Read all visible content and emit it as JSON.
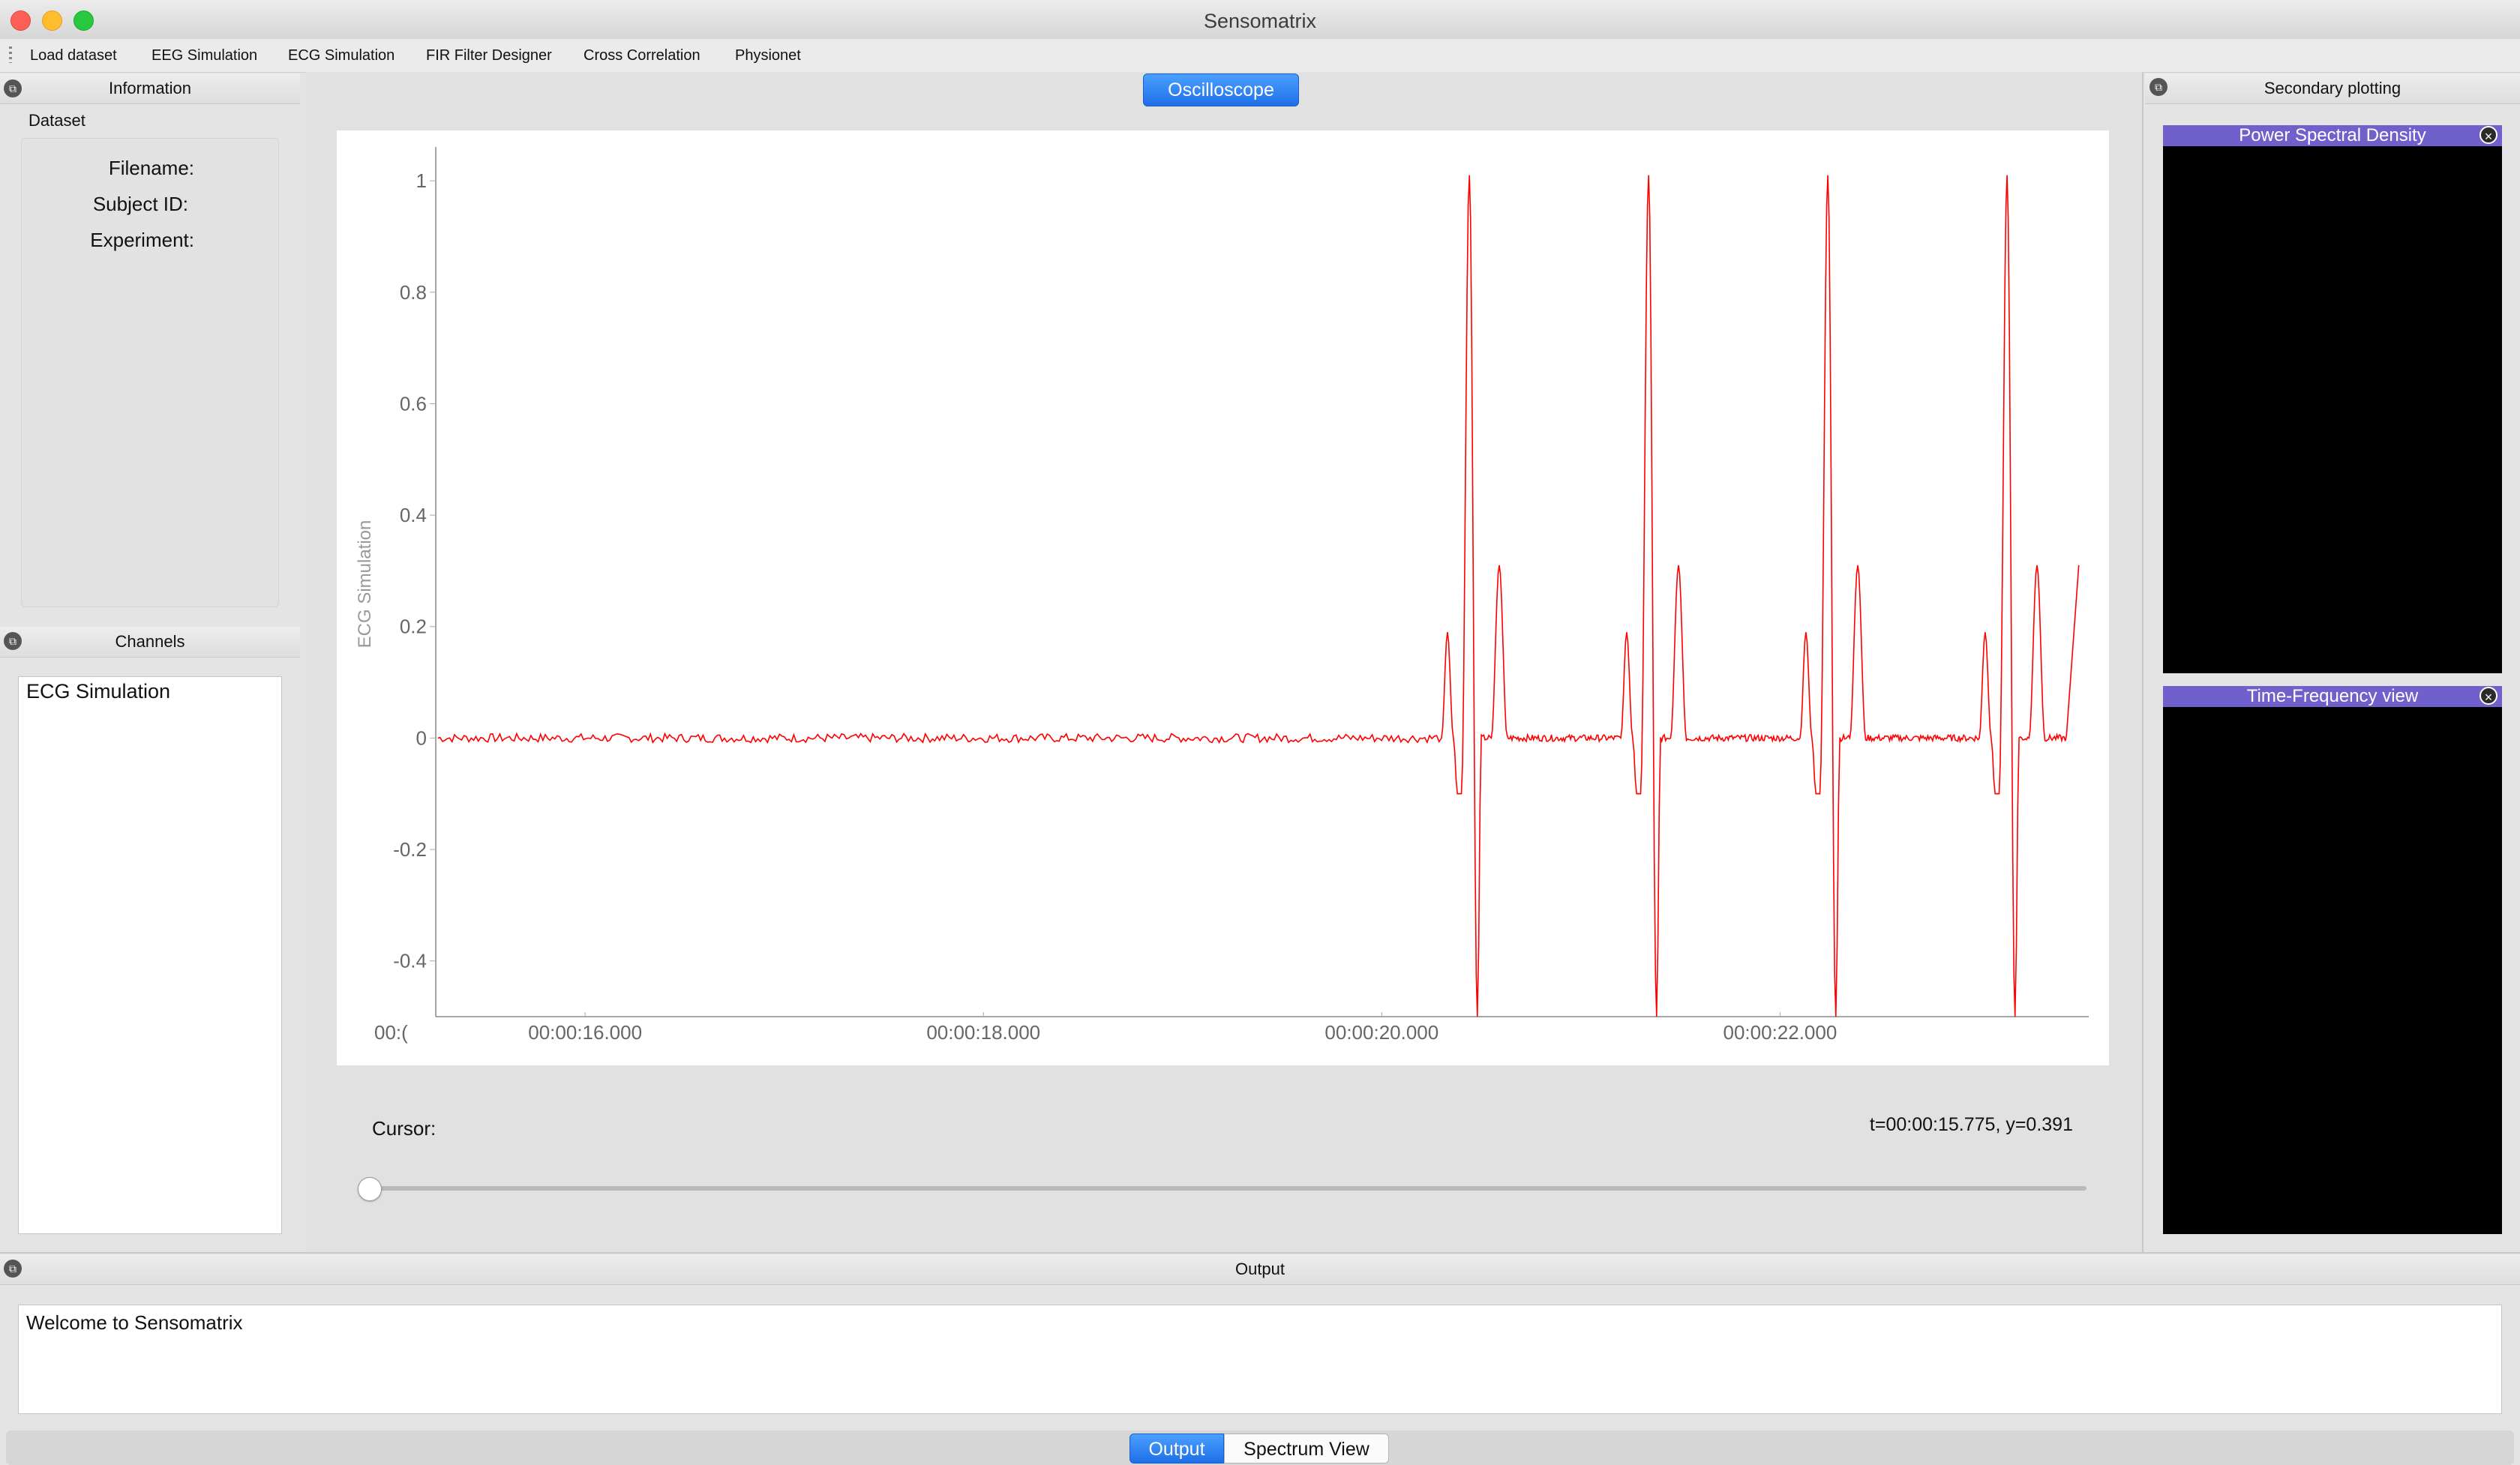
{
  "window": {
    "title": "Sensomatrix"
  },
  "menu": [
    "Load dataset",
    "EEG Simulation",
    "ECG Simulation",
    "FIR Filter Designer",
    "Cross Correlation",
    "Physionet"
  ],
  "info_panel": {
    "header": "Information",
    "section": "Dataset",
    "fields": {
      "filename": "Filename:",
      "subject_id": "Subject ID:",
      "experiment": "Experiment:"
    }
  },
  "channels_panel": {
    "header": "Channels",
    "items": [
      "ECG Simulation"
    ]
  },
  "oscilloscope": {
    "tab_label": "Oscilloscope",
    "cursor_label": "Cursor:",
    "cursor_readout": "t=00:00:15.775, y=0.391",
    "slider_value": 0
  },
  "secondary": {
    "header": "Secondary plotting",
    "psd_title": "Power Spectral Density",
    "tf_title": "Time-Frequency view"
  },
  "output": {
    "header": "Output",
    "message": "Welcome to Sensomatrix",
    "tabs": [
      "Output",
      "Spectrum View"
    ],
    "active_tab": "Output"
  },
  "colors": {
    "accent": "#1f6fe8",
    "trace": "#ff0000",
    "dock_title": "#7060cc"
  },
  "chart_data": {
    "type": "line",
    "ylabel": "ECG Simulation",
    "xlabel": "",
    "xlim_seconds": [
      15.25,
      23.55
    ],
    "ylim": [
      -0.5,
      1.05
    ],
    "y_ticks": [
      "1",
      "0.8",
      "0.6",
      "0.4",
      "0.2",
      "0",
      "-0.2",
      "-0.4"
    ],
    "x_tick_seconds": [
      16,
      18,
      20,
      22
    ],
    "x_ticks": [
      "00:00:16.000",
      "00:00:18.000",
      "00:00:20.000",
      "00:00:22.000"
    ],
    "x_first_tick_clipped": "00:(",
    "flat_until_seconds": 20.3,
    "beat_period_seconds": 0.9,
    "beat_count": 4,
    "beat_shape": [
      {
        "dt": 0.0,
        "y": 0.0
      },
      {
        "dt": 0.03,
        "y": 0.19
      },
      {
        "dt": 0.06,
        "y": 0.0
      },
      {
        "dt": 0.08,
        "y": -0.1
      },
      {
        "dt": 0.1,
        "y": -0.1
      },
      {
        "dt": 0.14,
        "y": 1.01
      },
      {
        "dt": 0.18,
        "y": -0.5
      },
      {
        "dt": 0.2,
        "y": 0.0
      },
      {
        "dt": 0.25,
        "y": 0.0
      },
      {
        "dt": 0.29,
        "y": 0.31
      },
      {
        "dt": 0.33,
        "y": 0.0
      },
      {
        "dt": 0.9,
        "y": 0.0
      }
    ],
    "end_seconds": 23.5,
    "end_value": 0.31,
    "grid": false,
    "legend": "none"
  }
}
